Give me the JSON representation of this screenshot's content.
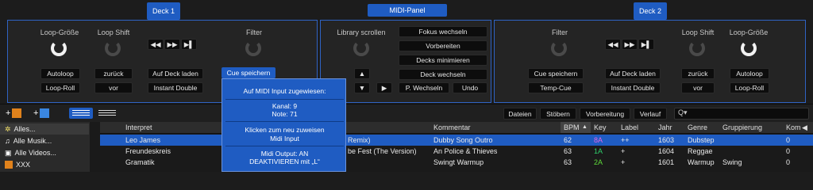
{
  "tabs": {
    "deck1": "Deck 1",
    "midi_panel": "MIDI-Panel",
    "deck2": "Deck 2"
  },
  "deck1": {
    "loop_size_label": "Loop-Größe",
    "loop_shift_label": "Loop Shift",
    "filter_label": "Filter",
    "autoloop": "Autoloop",
    "loop_roll": "Loop-Roll",
    "back": "zurück",
    "forward": "vor",
    "load_deck": "Auf Deck laden",
    "instant_double": "Instant Double",
    "cue_save": "Cue speichern",
    "transport": [
      "◀◀",
      "▶▶",
      "▶▌"
    ]
  },
  "library": {
    "scroll_label": "Library scrollen",
    "focus_switch": "Fokus wechseln",
    "prepare": "Vorbereiten",
    "minimize_decks": "Decks minimieren",
    "deck_switch": "Deck wechseln",
    "p_switch": "P. Wechseln",
    "and": "Undo",
    "arrows": [
      "▲",
      "◀",
      "▼",
      "▶"
    ]
  },
  "deck2": {
    "filter_label": "Filter",
    "loop_shift_label": "Loop Shift",
    "loop_size_label": "Loop-Größe",
    "cue_save": "Cue speichern",
    "temp_cue": "Temp-Cue",
    "load_deck": "Auf Deck laden",
    "instant_double": "Instant Double",
    "back": "zurück",
    "forward": "vor",
    "autoloop": "Autoloop",
    "loop_roll": "Loop-Roll",
    "transport": [
      "◀◀",
      "▶▶",
      "▶▌"
    ]
  },
  "popup": {
    "title": "Auf MIDI Input zugewiesen:",
    "channel": "Kanal: 9",
    "note": "Note: 71",
    "reassign_1": "Klicken zum neu zuweisen",
    "reassign_2": "Midi Input",
    "output_1": "Midi Output: AN",
    "output_2": "DEAKTIVIEREN mit „L“"
  },
  "toolbar": {
    "add1": "+",
    "add2": "+",
    "files": "Dateien",
    "browse": "Stöbern",
    "preparation": "Vorbereitung",
    "history": "Verlauf",
    "search_placeholder": "Q▾"
  },
  "sidebar": {
    "items": [
      {
        "label": "Alles...",
        "icon": "star-icon"
      },
      {
        "label": "Alle Musik...",
        "icon": "music-icon"
      },
      {
        "label": "Alle Videos...",
        "icon": "video-icon"
      },
      {
        "label": "XXX",
        "icon": "crate-icon"
      }
    ]
  },
  "table": {
    "columns": [
      "Interpret",
      "",
      "Kommentar",
      "BPM",
      "Key",
      "Label",
      "Jahr",
      "Genre",
      "Gruppierung",
      "Kom"
    ],
    "sort_indicator": "▲",
    "rows": [
      {
        "artist": "Leo James",
        "title": "Remix)",
        "comment": "Dubby Song Outro",
        "bpm": "62",
        "key": "8A",
        "label": "++",
        "year": "1603",
        "genre": "Dubstep",
        "group": "",
        "kom": "0"
      },
      {
        "artist": "Freundeskreis",
        "title": "be Fest (The Version)",
        "comment": "An Police & Thieves",
        "bpm": "63",
        "key": "1A",
        "label": "+",
        "year": "1604",
        "genre": "Reggae",
        "group": "",
        "kom": "0"
      },
      {
        "artist": "Gramatik",
        "title": "",
        "comment": "Swingt Warmup",
        "bpm": "63",
        "key": "2A",
        "label": "+",
        "year": "1601",
        "genre": "Warmup",
        "group": "Swing",
        "kom": "0"
      }
    ]
  },
  "colors": {
    "accent": "#1f5cc2",
    "key_8a": "#d14fd1",
    "key_1a": "#2fd16b",
    "key_2a": "#4fd12f",
    "selected_row": "#1f5cc2"
  }
}
